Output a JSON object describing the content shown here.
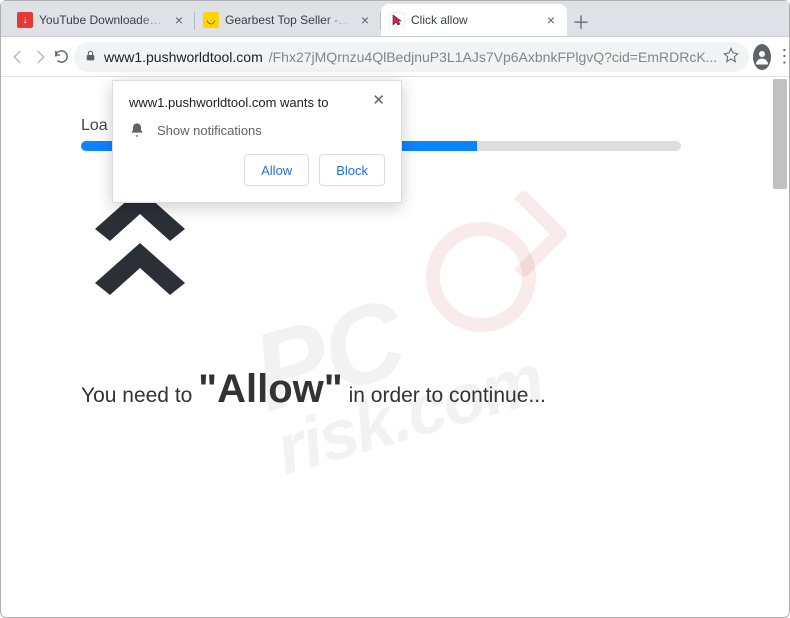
{
  "window": {
    "tabs": [
      {
        "title": "YouTube Downloader - Do",
        "favicon_bg": "#e53935",
        "favicon_glyph": "↓",
        "active": false
      },
      {
        "title": "Gearbest Top Seller - Dive",
        "favicon_bg": "#ffd400",
        "favicon_glyph": "◡",
        "active": false
      },
      {
        "title": "Click allow",
        "favicon_bg": "#ffffff",
        "favicon_glyph": "",
        "active": true
      }
    ]
  },
  "toolbar": {
    "url_host": "www1.pushworldtool.com",
    "url_path": "/Fhx27jMQrnzu4QlBedjnuP3L1AJs7Vp6AxbnkFPlgvQ?cid=EmRDRcK..."
  },
  "permission_dialog": {
    "origin_line": "www1.pushworldtool.com wants to",
    "permission_label": "Show notifications",
    "allow_label": "Allow",
    "block_label": "Block"
  },
  "page": {
    "loading_prefix": "Loa",
    "progress_percent": 66,
    "message_prefix": "You need to ",
    "message_big": "\"Allow\"",
    "message_suffix": " in order to continue..."
  },
  "watermark": {
    "line1": "PC",
    "line2": "risk.com"
  }
}
